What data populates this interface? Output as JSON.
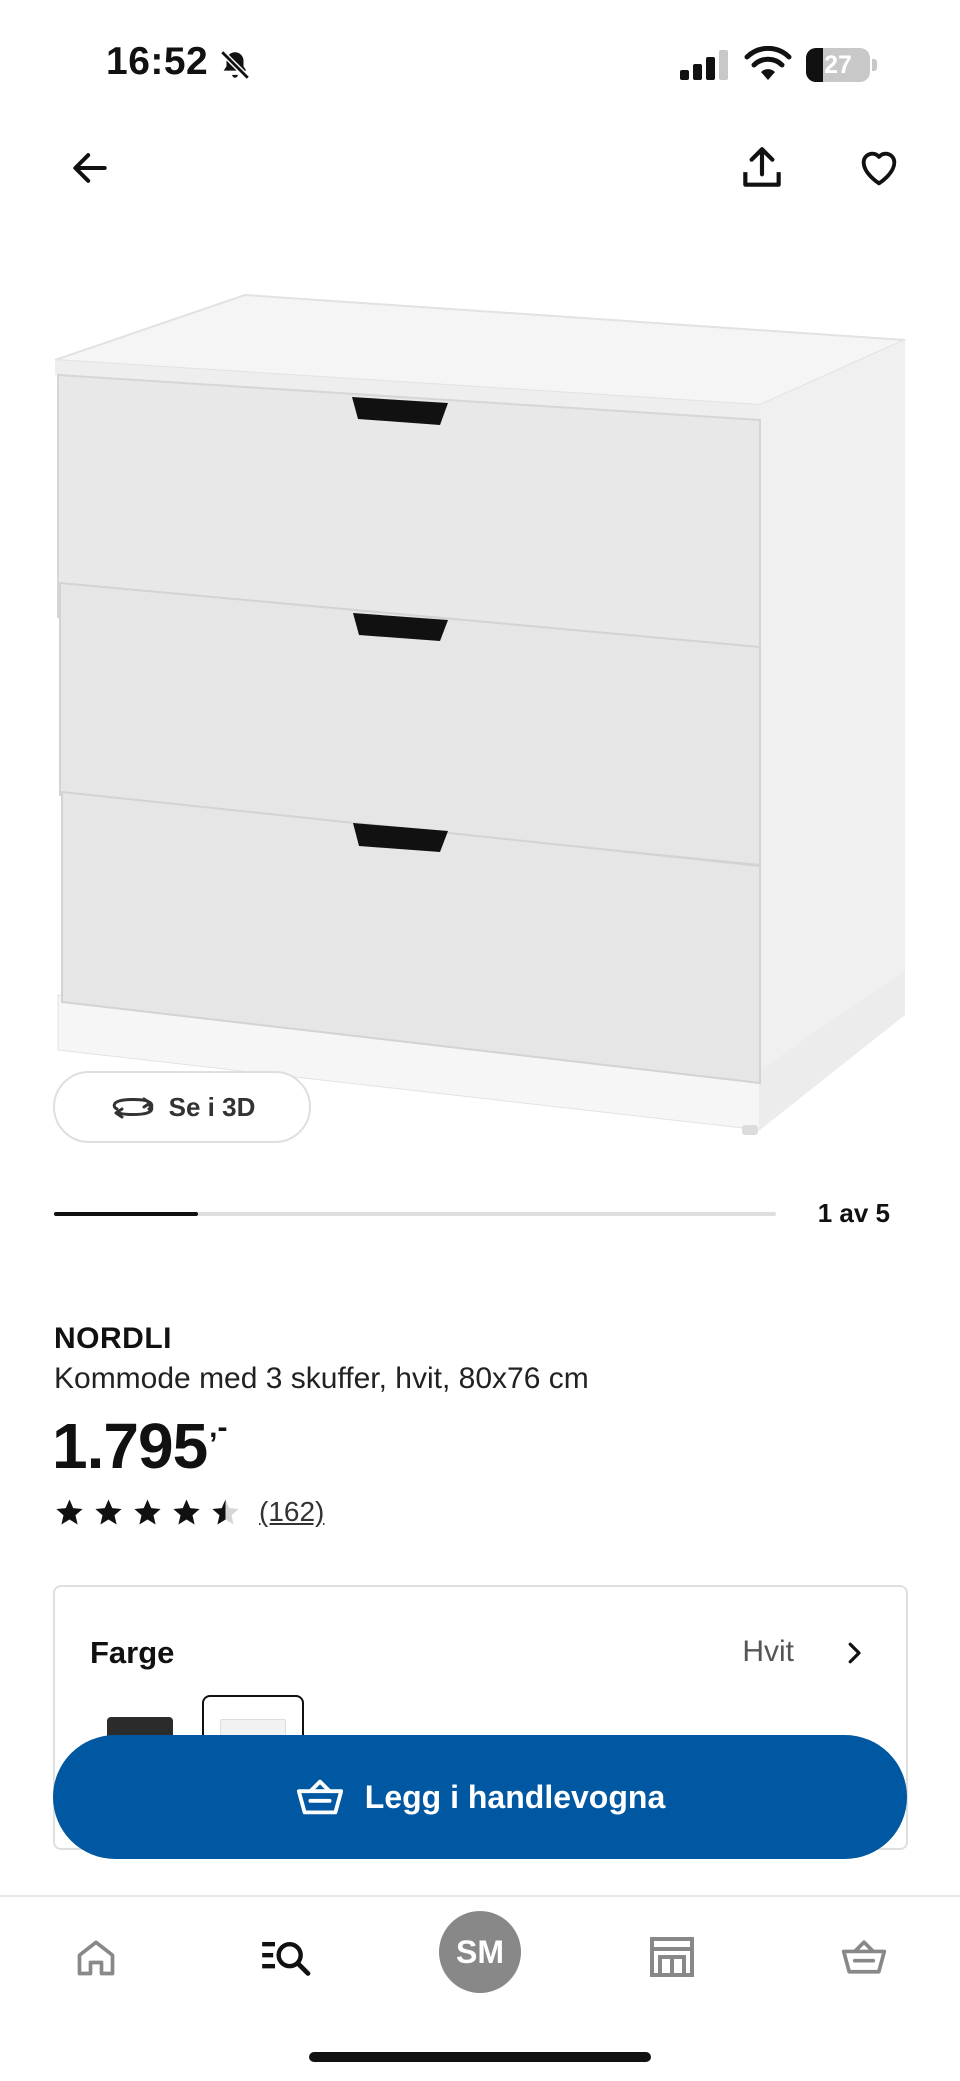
{
  "status_bar": {
    "time": "16:52",
    "battery": "27",
    "battery_level": 0.27,
    "icons": [
      "bell-slash-icon",
      "cellular-signal-icon",
      "wifi-icon",
      "battery-icon"
    ]
  },
  "nav": {
    "back_icon": "arrow-left-icon",
    "share_icon": "share-icon",
    "favorite_icon": "heart-icon"
  },
  "gallery": {
    "view_3d_label": "Se i 3D",
    "view_3d_icon": "rotate-3d-icon",
    "counter": "1 av 5",
    "progress": 0.2
  },
  "product": {
    "name": "NORDLI",
    "description": "Kommode med 3 skuffer, hvit, 80x76 cm",
    "price": "1.795",
    "price_suffix": ",-",
    "rating": 4.5,
    "rating_max": 5,
    "review_count": "(162)"
  },
  "color_selector": {
    "label": "Farge",
    "selected": "Hvit",
    "options": [
      "black",
      "white"
    ],
    "selected_index": 1
  },
  "cart_button": {
    "label": "Legg i handlevogna",
    "icon": "basket-icon",
    "color": "#0058a3"
  },
  "tab_bar": {
    "profile_initials": "SM",
    "items": [
      "home-icon",
      "search-list-icon",
      "profile-avatar",
      "store-icon",
      "basket-icon"
    ]
  }
}
